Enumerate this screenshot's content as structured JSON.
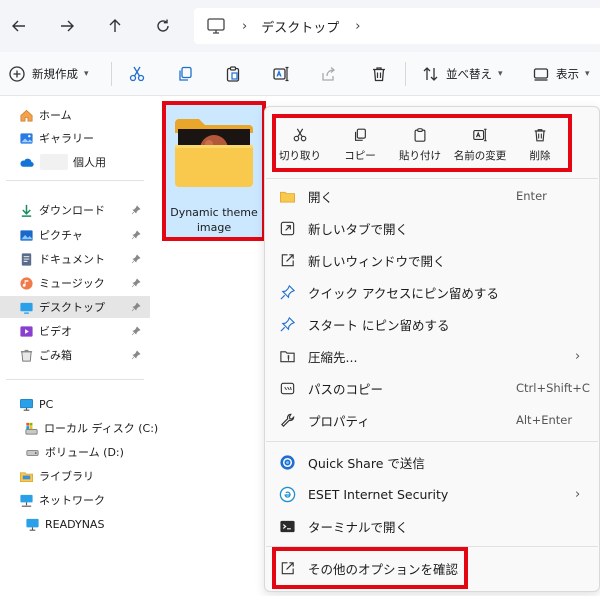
{
  "nav": {
    "breadcrumb": "デスクトップ",
    "separator": "›"
  },
  "toolbar": {
    "new_label": "新規作成",
    "sort_label": "並べ替え",
    "view_label": "表示"
  },
  "sidebar": {
    "items": [
      {
        "label": "ホーム",
        "icon": "home-icon"
      },
      {
        "label": "ギャラリー",
        "icon": "gallery-icon"
      },
      {
        "label": "個人用",
        "icon": "onedrive-icon"
      },
      {
        "label": "ダウンロード",
        "icon": "download-icon"
      },
      {
        "label": "ピクチャ",
        "icon": "pictures-icon"
      },
      {
        "label": "ドキュメント",
        "icon": "documents-icon"
      },
      {
        "label": "ミュージック",
        "icon": "music-icon"
      },
      {
        "label": "デスクトップ",
        "icon": "desktop-icon"
      },
      {
        "label": "ビデオ",
        "icon": "video-icon"
      },
      {
        "label": "ごみ箱",
        "icon": "recycle-bin-icon"
      },
      {
        "label": "PC",
        "icon": "pc-icon"
      },
      {
        "label": "ローカル ディスク (C:)",
        "icon": "drive-c-icon"
      },
      {
        "label": "ボリューム (D:)",
        "icon": "drive-d-icon"
      },
      {
        "label": "ライブラリ",
        "icon": "library-icon"
      },
      {
        "label": "ネットワーク",
        "icon": "network-icon"
      },
      {
        "label": "READYNAS",
        "icon": "nas-icon"
      }
    ]
  },
  "folder": {
    "name": "Dynamic theme image"
  },
  "context_menu": {
    "quick_actions": [
      {
        "label": "切り取り",
        "icon": "cut-icon"
      },
      {
        "label": "コピー",
        "icon": "copy-icon"
      },
      {
        "label": "貼り付け",
        "icon": "paste-icon"
      },
      {
        "label": "名前の変更",
        "icon": "rename-icon"
      },
      {
        "label": "削除",
        "icon": "delete-icon"
      }
    ],
    "items": [
      {
        "label": "開く",
        "shortcut": "Enter",
        "icon": "folder-open-icon"
      },
      {
        "label": "新しいタブで開く",
        "shortcut": "",
        "icon": "new-tab-icon"
      },
      {
        "label": "新しいウィンドウで開く",
        "shortcut": "",
        "icon": "new-window-icon"
      },
      {
        "label": "クイック アクセスにピン留めする",
        "shortcut": "",
        "icon": "pin-icon"
      },
      {
        "label": "スタート にピン留めする",
        "shortcut": "",
        "icon": "pin-start-icon"
      },
      {
        "label": "圧縮先...",
        "shortcut": "",
        "icon": "compress-icon",
        "submenu": true
      },
      {
        "label": "パスのコピー",
        "shortcut": "Ctrl+Shift+C",
        "icon": "copy-path-icon"
      },
      {
        "label": "プロパティ",
        "shortcut": "Alt+Enter",
        "icon": "properties-icon"
      },
      {
        "label": "Quick Share で送信",
        "shortcut": "",
        "icon": "quick-share-icon"
      },
      {
        "label": "ESET Internet Security",
        "shortcut": "",
        "icon": "eset-icon",
        "submenu": true
      },
      {
        "label": "ターミナルで開く",
        "shortcut": "",
        "icon": "terminal-icon"
      },
      {
        "label": "その他のオプションを確認",
        "shortcut": "",
        "icon": "more-options-icon"
      }
    ],
    "submenu_arrow": "›"
  },
  "colors": {
    "highlight_red": "#e30613",
    "selection_blue": "#cce8ff",
    "folder_yellow": "#f8c94c",
    "accent_blue": "#1f6fd1"
  }
}
